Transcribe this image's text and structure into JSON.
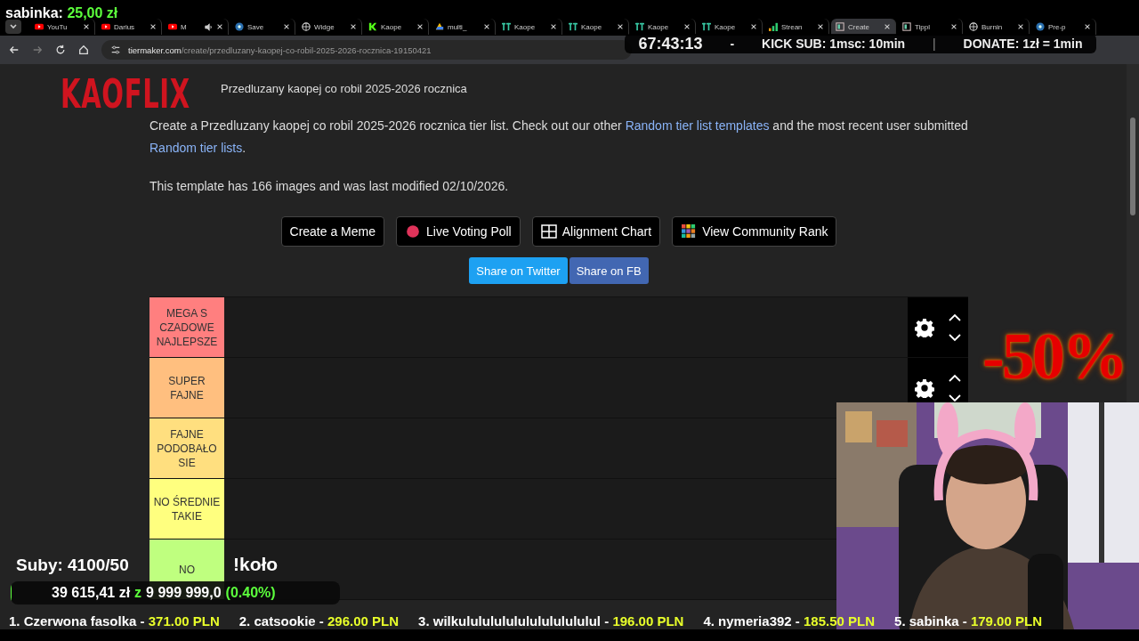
{
  "donor_alert": {
    "name": "sabinka:",
    "amount": "25,00 zł"
  },
  "tabs": [
    {
      "label": "YouTu",
      "kind": "video",
      "selected": false,
      "audio": false
    },
    {
      "label": "Darius",
      "kind": "video",
      "selected": false,
      "audio": false
    },
    {
      "label": "M",
      "kind": "video",
      "selected": false,
      "audio": true
    },
    {
      "label": "Save",
      "kind": "disc",
      "selected": false,
      "audio": false
    },
    {
      "label": "Widge",
      "kind": "globe",
      "selected": false,
      "audio": false
    },
    {
      "label": "Kaope",
      "kind": "mark",
      "selected": false,
      "audio": false
    },
    {
      "label": "multi_",
      "kind": "triangle",
      "selected": false,
      "audio": false
    },
    {
      "label": "Kaope",
      "kind": "tiles",
      "selected": false,
      "audio": false
    },
    {
      "label": "Kaope",
      "kind": "tiles",
      "selected": false,
      "audio": false
    },
    {
      "label": "Kaope",
      "kind": "tiles",
      "selected": false,
      "audio": false
    },
    {
      "label": "Kaope",
      "kind": "tiles",
      "selected": false,
      "audio": false
    },
    {
      "label": "Strean",
      "kind": "bars",
      "selected": false,
      "audio": false
    },
    {
      "label": "Create",
      "kind": "page",
      "selected": true,
      "audio": false
    },
    {
      "label": "Tippl",
      "kind": "page",
      "selected": false,
      "audio": false
    },
    {
      "label": "Burnin",
      "kind": "globe",
      "selected": false,
      "audio": false
    },
    {
      "label": "Pre-p",
      "kind": "disc",
      "selected": false,
      "audio": false
    }
  ],
  "address_bar": {
    "host": "tiermaker.com",
    "path": "/create/przedluzany-kaopej-co-robil-2025-2026-rocznica-19150421"
  },
  "timer_overlay": {
    "time": "67:43:13",
    "separator": "-",
    "kick_sub": "KICK SUB: 1msc: 10min",
    "divider": "|",
    "donate": "DONATE: 1zł = 1min"
  },
  "logo": "KAOFLIX",
  "page": {
    "title": "Przedluzany kaopej co robil 2025-2026 rocznica",
    "description": [
      {
        "kind": "text",
        "text": "Create a Przedluzany kaopej co robil 2025-2026 rocznica tier list. Check out our other "
      },
      {
        "kind": "link",
        "text": "Random tier list templates"
      },
      {
        "kind": "text",
        "text": " and the most recent user submitted "
      },
      {
        "kind": "link",
        "text": "Random tier lists"
      },
      {
        "kind": "text",
        "text": "."
      }
    ],
    "info": "This template has 166 images and was last modified 02/10/2026.",
    "buttons": [
      {
        "label": "Create a Meme",
        "kind": "plain"
      },
      {
        "label": "Live Voting Poll",
        "kind": "dot"
      },
      {
        "label": "Alignment Chart",
        "kind": "grid"
      },
      {
        "label": "View Community Rank",
        "kind": "mosaic"
      }
    ],
    "share_buttons": [
      {
        "label": "Share on Twitter",
        "color": "#1da1f2"
      },
      {
        "label": "Share on FB",
        "color": "#4267b2"
      }
    ],
    "tiers": [
      {
        "label": "MEGA S CZADOWE NAJLEPSZE",
        "color": "#ff7f7f"
      },
      {
        "label": "SUPER FAJNE",
        "color": "#ffbf7f"
      },
      {
        "label": "FAJNE PODOBAŁO SIE",
        "color": "#ffdf7f"
      },
      {
        "label": "NO ŚREDNIE TAKIE",
        "color": "#ffff7f"
      },
      {
        "label": "NO",
        "color": "#bfff7f"
      }
    ]
  },
  "promo": "-50%",
  "sub_goal": {
    "label": "Suby: 4100/50",
    "command": "!koło",
    "raised": "39 615,41 zł",
    "of": "z",
    "goal": "9 999 999,0",
    "percent": "(0.40%)",
    "level": 0.004
  },
  "ticker": [
    {
      "rank": "1. Czerwona fasolka -",
      "amount": "371.00 PLN"
    },
    {
      "rank": "2. catsookie -",
      "amount": "296.00 PLN"
    },
    {
      "rank": "3. wilkulululululululululululul -",
      "amount": "196.00 PLN"
    },
    {
      "rank": "4. nymeria392 -",
      "amount": "185.50 PLN"
    },
    {
      "rank": "5. sabinka -",
      "amount": "179.00 PLN"
    }
  ]
}
